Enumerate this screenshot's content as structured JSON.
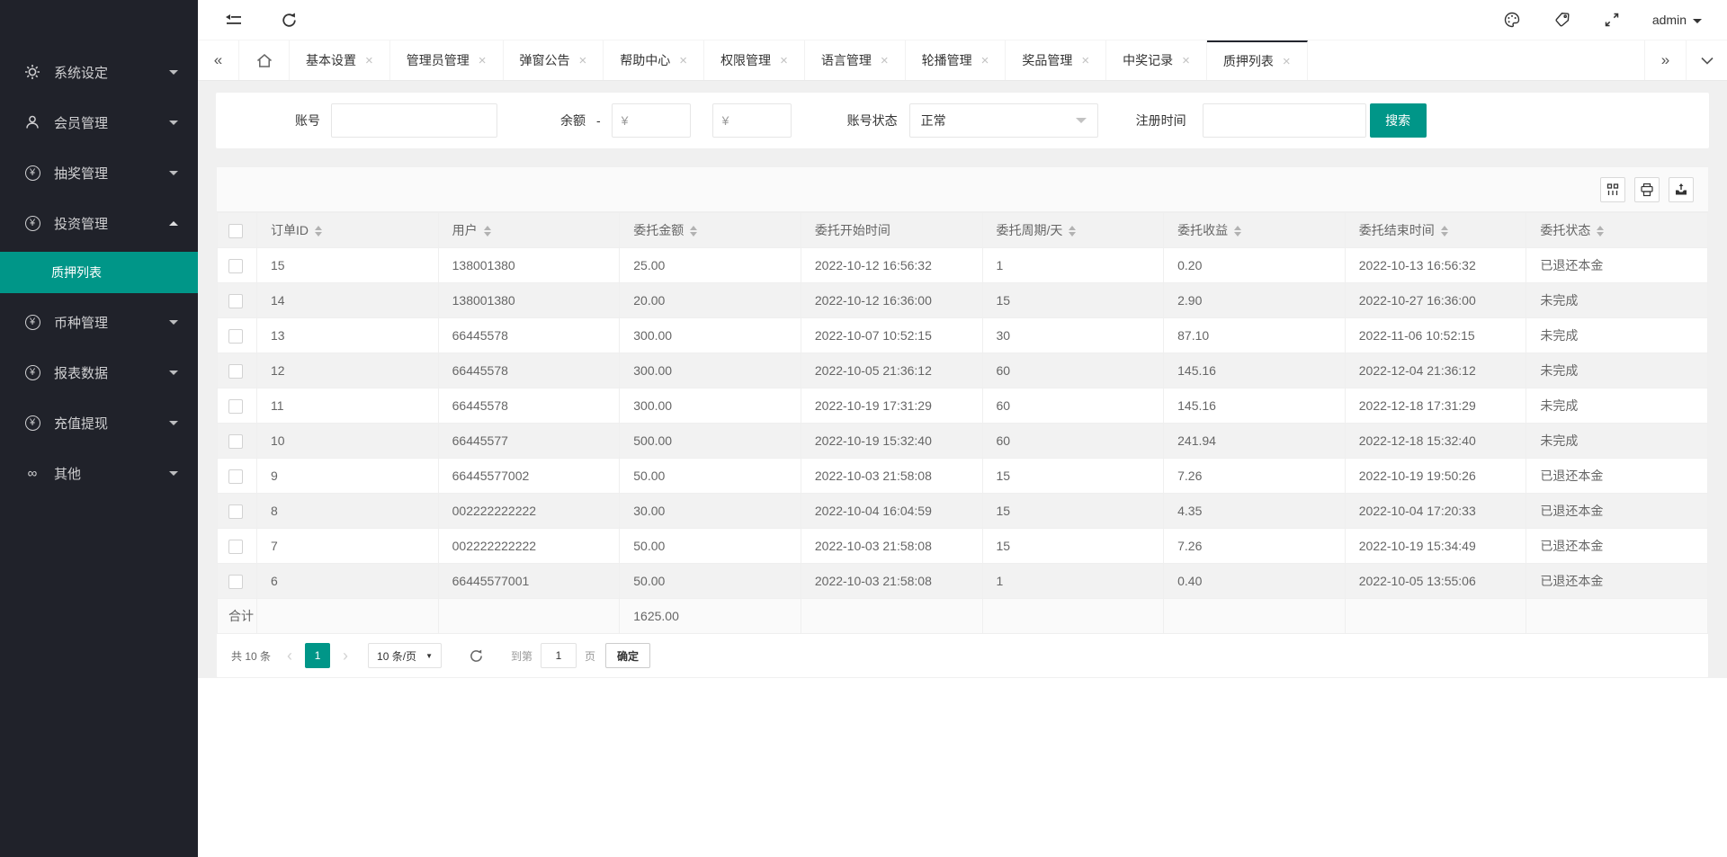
{
  "colors": {
    "accent": "#009688",
    "sidebar_bg": "#20222a",
    "tab_active_border": "#23262e",
    "header_row_bg": "#f2f2f2"
  },
  "topbar": {
    "left_icons": [
      "collapse-menu-icon",
      "refresh-icon"
    ],
    "right_icons": [
      "palette-icon",
      "tag-icon",
      "fullscreen-icon"
    ],
    "username": "admin"
  },
  "sidebar": {
    "items": [
      {
        "name": "system-settings",
        "icon": "gear-icon",
        "label": "系统设定",
        "expanded": false
      },
      {
        "name": "member-management",
        "icon": "user-icon",
        "label": "会员管理",
        "expanded": false
      },
      {
        "name": "lottery-management",
        "icon": "yen-icon",
        "label": "抽奖管理",
        "expanded": false
      },
      {
        "name": "investment-management",
        "icon": "yen-icon",
        "label": "投资管理",
        "expanded": true,
        "children": [
          {
            "name": "pledge-list",
            "label": "质押列表",
            "active": true
          }
        ]
      },
      {
        "name": "currency-management",
        "icon": "yen-icon",
        "label": "币种管理",
        "expanded": false
      },
      {
        "name": "report-data",
        "icon": "yen-icon",
        "label": "报表数据",
        "expanded": false
      },
      {
        "name": "recharge-withdrawal",
        "icon": "yen-icon",
        "label": "充值提现",
        "expanded": false
      },
      {
        "name": "other",
        "icon": "infinity-icon",
        "label": "其他",
        "expanded": false
      }
    ]
  },
  "tabs": {
    "items": [
      {
        "label": "基本设置",
        "active": false
      },
      {
        "label": "管理员管理",
        "active": false
      },
      {
        "label": "弹窗公告",
        "active": false
      },
      {
        "label": "帮助中心",
        "active": false
      },
      {
        "label": "权限管理",
        "active": false
      },
      {
        "label": "语言管理",
        "active": false
      },
      {
        "label": "轮播管理",
        "active": false
      },
      {
        "label": "奖品管理",
        "active": false
      },
      {
        "label": "中奖记录",
        "active": false
      },
      {
        "label": "质押列表",
        "active": true
      }
    ]
  },
  "filter": {
    "account_label": "账号",
    "balance_label": "余额",
    "balance_separator": "-",
    "balance_min_placeholder": "¥",
    "balance_max_placeholder": "¥",
    "status_label": "账号状态",
    "status_value": "正常",
    "regtime_label": "注册时间",
    "search_button": "搜索"
  },
  "table": {
    "toolbar_icons": [
      "columns-filter-icon",
      "print-icon",
      "export-icon"
    ],
    "columns": [
      "订单ID",
      "用户",
      "委托金额",
      "委托开始时间",
      "委托周期/天",
      "委托收益",
      "委托结束时间",
      "委托状态"
    ],
    "sortable": [
      true,
      true,
      true,
      false,
      true,
      true,
      true,
      true
    ],
    "rows": [
      [
        "15",
        "138001380",
        "25.00",
        "2022-10-12 16:56:32",
        "1",
        "0.20",
        "2022-10-13 16:56:32",
        "已退还本金"
      ],
      [
        "14",
        "138001380",
        "20.00",
        "2022-10-12 16:36:00",
        "15",
        "2.90",
        "2022-10-27 16:36:00",
        "未完成"
      ],
      [
        "13",
        "66445578",
        "300.00",
        "2022-10-07 10:52:15",
        "30",
        "87.10",
        "2022-11-06 10:52:15",
        "未完成"
      ],
      [
        "12",
        "66445578",
        "300.00",
        "2022-10-05 21:36:12",
        "60",
        "145.16",
        "2022-12-04 21:36:12",
        "未完成"
      ],
      [
        "11",
        "66445578",
        "300.00",
        "2022-10-19 17:31:29",
        "60",
        "145.16",
        "2022-12-18 17:31:29",
        "未完成"
      ],
      [
        "10",
        "66445577",
        "500.00",
        "2022-10-19 15:32:40",
        "60",
        "241.94",
        "2022-12-18 15:32:40",
        "未完成"
      ],
      [
        "9",
        "66445577002",
        "50.00",
        "2022-10-03 21:58:08",
        "15",
        "7.26",
        "2022-10-19 19:50:26",
        "已退还本金"
      ],
      [
        "8",
        "002222222222",
        "30.00",
        "2022-10-04 16:04:59",
        "15",
        "4.35",
        "2022-10-04 17:20:33",
        "已退还本金"
      ],
      [
        "7",
        "002222222222",
        "50.00",
        "2022-10-03 21:58:08",
        "15",
        "7.26",
        "2022-10-19 15:34:49",
        "已退还本金"
      ],
      [
        "6",
        "66445577001",
        "50.00",
        "2022-10-03 21:58:08",
        "1",
        "0.40",
        "2022-10-05 13:55:06",
        "已退还本金"
      ]
    ],
    "summary_label": "合计",
    "summary_amount": "1625.00",
    "summary_amount_column": "委托金额"
  },
  "pagination": {
    "total_text": "共 10 条",
    "current_page": "1",
    "page_size_text": "10 条/页",
    "goto_label": "到第",
    "goto_value": "1",
    "page_unit": "页",
    "confirm_button": "确定"
  }
}
